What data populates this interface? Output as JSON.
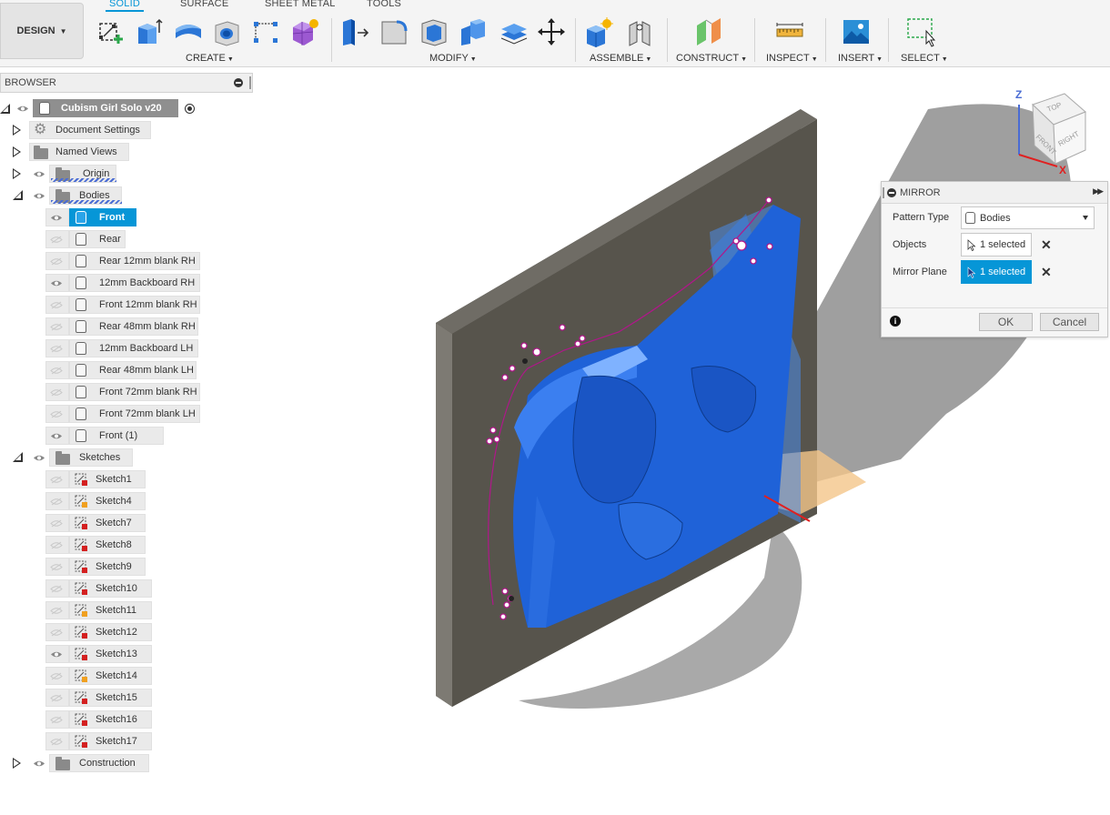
{
  "workspace": {
    "label": "DESIGN"
  },
  "tabs": [
    "SOLID",
    "SURFACE",
    "SHEET METAL",
    "TOOLS"
  ],
  "toolbar_groups": {
    "create": "CREATE",
    "modify": "MODIFY",
    "assemble": "ASSEMBLE",
    "construct": "CONSTRUCT",
    "inspect": "INSPECT",
    "insert": "INSERT",
    "select": "SELECT"
  },
  "browser": {
    "title": "BROWSER",
    "root": "Cubism Girl Solo v20",
    "document_settings": "Document Settings",
    "named_views": "Named Views",
    "origin": "Origin",
    "bodies_folder": "Bodies",
    "bodies": [
      {
        "label": "Front",
        "visible": true,
        "selected": true
      },
      {
        "label": "Rear",
        "visible": false
      },
      {
        "label": "Rear 12mm blank RH",
        "visible": false
      },
      {
        "label": "12mm Backboard RH",
        "visible": true
      },
      {
        "label": "Front 12mm blank RH",
        "visible": false
      },
      {
        "label": "Rear 48mm blank RH",
        "visible": false
      },
      {
        "label": "12mm Backboard LH",
        "visible": false
      },
      {
        "label": "Rear 48mm blank LH",
        "visible": false
      },
      {
        "label": "Front  72mm blank RH",
        "visible": false
      },
      {
        "label": "Front  72mm blank LH",
        "visible": false
      },
      {
        "label": "Front (1)",
        "visible": true
      }
    ],
    "sketches_folder": "Sketches",
    "sketches": [
      {
        "label": "Sketch1",
        "visible": false
      },
      {
        "label": "Sketch4",
        "visible": false
      },
      {
        "label": "Sketch7",
        "visible": false
      },
      {
        "label": "Sketch8",
        "visible": false
      },
      {
        "label": "Sketch9",
        "visible": false
      },
      {
        "label": "Sketch10",
        "visible": false
      },
      {
        "label": "Sketch11",
        "visible": false
      },
      {
        "label": "Sketch12",
        "visible": false
      },
      {
        "label": "Sketch13",
        "visible": true
      },
      {
        "label": "Sketch14",
        "visible": false
      },
      {
        "label": "Sketch15",
        "visible": false
      },
      {
        "label": "Sketch16",
        "visible": false
      },
      {
        "label": "Sketch17",
        "visible": false
      }
    ],
    "construction_folder": "Construction"
  },
  "viewcube": {
    "top": "TOP",
    "front": "FRONT",
    "right": "RIGHT",
    "z_axis": "Z",
    "x_axis": "X"
  },
  "mirror_dialog": {
    "title": "MIRROR",
    "pattern_type_label": "Pattern Type",
    "pattern_type_value": "Bodies",
    "objects_label": "Objects",
    "objects_value": "1 selected",
    "mirror_plane_label": "Mirror Plane",
    "mirror_plane_value": "1 selected",
    "ok_label": "OK",
    "cancel_label": "Cancel"
  },
  "colors": {
    "accent": "#0696d7",
    "body_blue": "#1f6fe0",
    "backboard": "#5e5a52",
    "sketch_magenta": "#b0178a"
  }
}
